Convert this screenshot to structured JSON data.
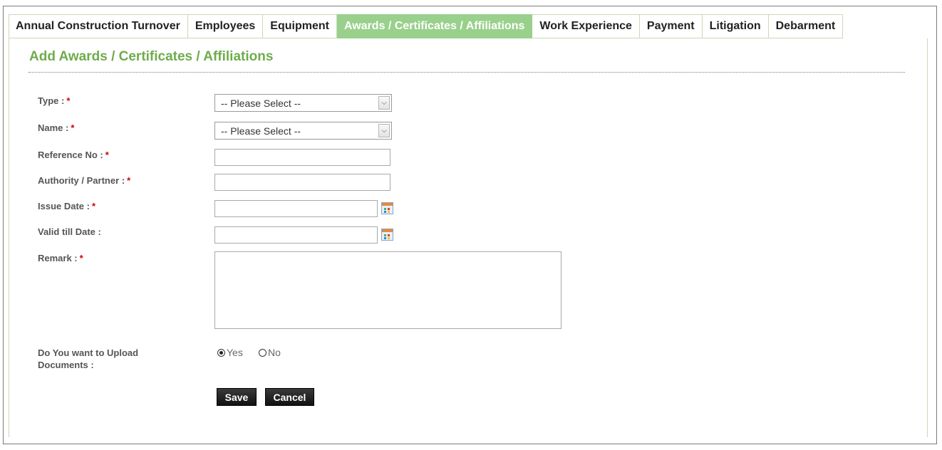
{
  "tabs": [
    {
      "label": "Annual Construction Turnover",
      "active": false
    },
    {
      "label": "Employees",
      "active": false
    },
    {
      "label": "Equipment",
      "active": false
    },
    {
      "label": "Awards / Certificates / Affiliations",
      "active": true
    },
    {
      "label": "Work Experience",
      "active": false
    },
    {
      "label": "Payment",
      "active": false
    },
    {
      "label": "Litigation",
      "active": false
    },
    {
      "label": "Debarment",
      "active": false
    }
  ],
  "form": {
    "title": "Add Awards / Certificates / Affiliations",
    "required_marker": "*",
    "fields": {
      "type": {
        "label": "Type :",
        "value": "-- Please Select --"
      },
      "name": {
        "label": "Name :",
        "value": "-- Please Select --"
      },
      "reference_no": {
        "label": "Reference No :",
        "value": ""
      },
      "authority": {
        "label": "Authority / Partner :",
        "value": ""
      },
      "issue_date": {
        "label": "Issue Date :",
        "value": ""
      },
      "valid_till": {
        "label": "Valid till Date :",
        "value": ""
      },
      "remark": {
        "label": "Remark :",
        "value": ""
      }
    },
    "upload": {
      "label_line1": "Do You want to Upload",
      "label_line2": "Documents :",
      "yes": "Yes",
      "no": "No",
      "selected": "Yes"
    },
    "buttons": {
      "save": "Save",
      "cancel": "Cancel"
    }
  },
  "colors": {
    "accent": "#6fac4c",
    "active_tab": "#99d08c",
    "required": "#d40000"
  },
  "icons": {
    "date_picker": "calendar-icon",
    "dropdown": "chevron-down-icon"
  }
}
